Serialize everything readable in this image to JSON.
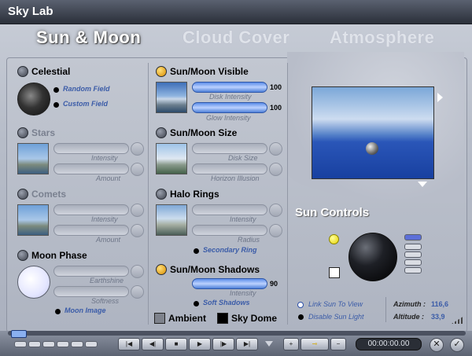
{
  "window": {
    "title": "Sky Lab"
  },
  "tabs": [
    {
      "label": "Sun & Moon",
      "active": true
    },
    {
      "label": "Cloud Cover",
      "active": false
    },
    {
      "label": "Atmosphere",
      "active": false
    }
  ],
  "celestial": {
    "label": "Celestial",
    "options": [
      "Random Field",
      "Custom Field"
    ]
  },
  "stars": {
    "label": "Stars",
    "sliders": [
      "Intensity",
      "Amount"
    ]
  },
  "comets": {
    "label": "Comets",
    "sliders": [
      "Intensity",
      "Amount"
    ]
  },
  "moon_phase": {
    "label": "Moon Phase",
    "sliders": [
      "Earthshine",
      "Softness"
    ],
    "link": "Moon Image"
  },
  "sun_moon_visible": {
    "label": "Sun/Moon Visible",
    "disk_intensity": {
      "label": "Disk Intensity",
      "value": "100"
    },
    "glow_intensity": {
      "label": "Glow Intensity",
      "value": "100"
    }
  },
  "sun_moon_size": {
    "label": "Sun/Moon Size",
    "sliders": [
      "Disk Size",
      "Horizon Illusion"
    ]
  },
  "halo_rings": {
    "label": "Halo Rings",
    "sliders": [
      "Intensity",
      "Radius"
    ],
    "link": "Secondary Ring"
  },
  "sun_moon_shadows": {
    "label": "Sun/Moon Shadows",
    "intensity": {
      "label": "Intensity",
      "value": "90"
    },
    "link": "Soft Shadows"
  },
  "ambient": {
    "label": "Ambient"
  },
  "sky_dome": {
    "label": "Sky Dome"
  },
  "sun_controls": {
    "title": "Sun Controls",
    "link_sun": "Link Sun To View",
    "disable_sun": "Disable Sun Light",
    "azimuth_label": "Azimuth :",
    "azimuth_value": "116,6",
    "altitude_label": "Altitude :",
    "altitude_value": "33,9"
  },
  "timeline": {
    "time": "00:00:00.00"
  },
  "colors": {
    "accent_blue": "#3b5ca8",
    "active_dot": "#f2b400"
  }
}
